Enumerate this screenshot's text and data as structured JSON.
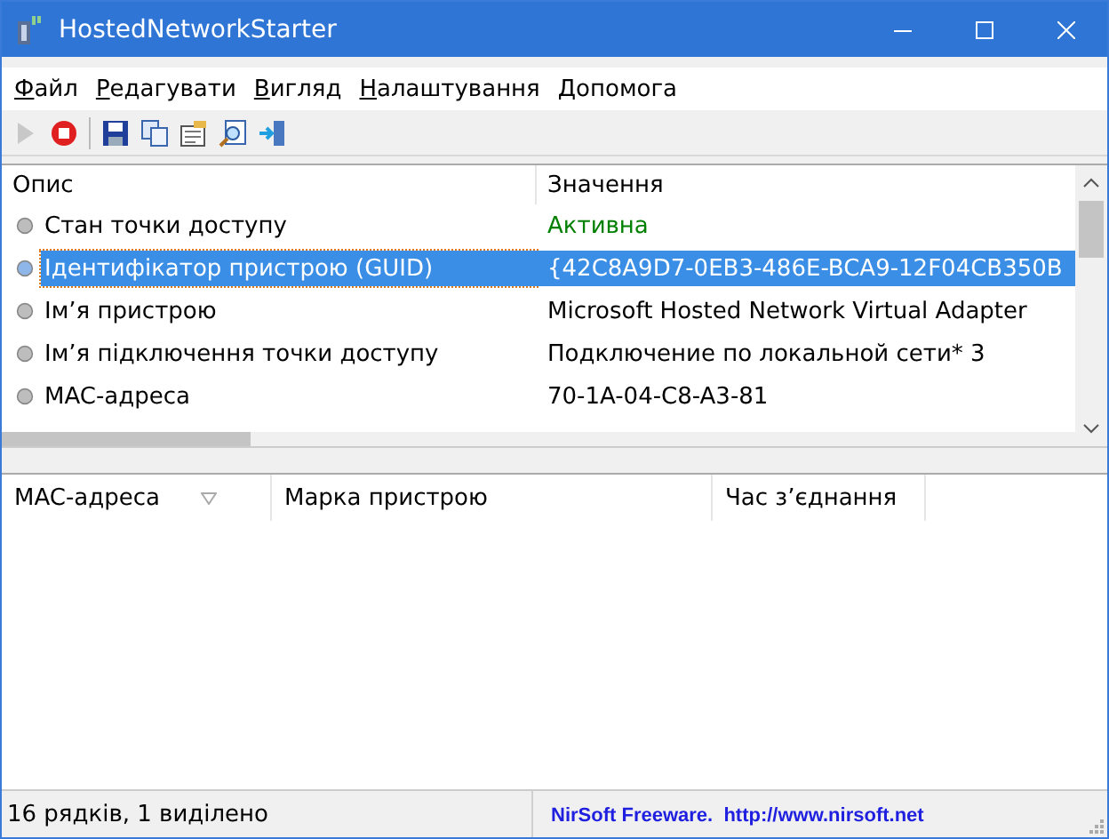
{
  "window": {
    "title": "HostedNetworkStarter"
  },
  "menu": [
    "Файл",
    "Редагувати",
    "Вигляд",
    "Налаштування",
    "Допомога"
  ],
  "toolbar": [
    {
      "kind": "play",
      "disabled": true
    },
    {
      "kind": "stop",
      "disabled": false
    },
    {
      "kind": "save",
      "disabled": false
    },
    {
      "kind": "copy",
      "disabled": false
    },
    {
      "kind": "properties",
      "disabled": false
    },
    {
      "kind": "find",
      "disabled": false
    },
    {
      "kind": "exit",
      "disabled": false
    }
  ],
  "properties": {
    "columns": [
      "Опис",
      "Значення"
    ],
    "rows": [
      {
        "name": "Стан точки доступу",
        "value": "Активна",
        "color": "#008000",
        "selected": false
      },
      {
        "name": "Ідентифікатор пристрою (GUID)",
        "value": "{42C8A9D7-0EB3-486E-BCA9-12F04CB350B",
        "selected": true
      },
      {
        "name": "Ім’я пристрою",
        "value": "Microsoft Hosted Network Virtual Adapter",
        "color": "#000000",
        "selected": false
      },
      {
        "name": "Ім’я підключення точки доступу",
        "value": "Подключение по локальной сети* 3",
        "color": "#000000",
        "selected": false
      },
      {
        "name": "MAC-адреса",
        "value": "70-1A-04-C8-A3-81",
        "color": "#000000",
        "selected": false
      }
    ]
  },
  "clients": {
    "columns": [
      {
        "label": "MAC-адреса",
        "sorted": true
      },
      {
        "label": "Марка пристрою",
        "sorted": false
      },
      {
        "label": "Час з’єднання",
        "sorted": false
      }
    ]
  },
  "status_bar": {
    "text": "16 рядків, 1 виділено",
    "link": "NirSoft Freeware.  http://www.nirsoft.net"
  }
}
